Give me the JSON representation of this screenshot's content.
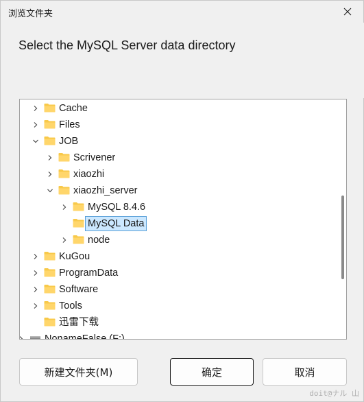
{
  "window": {
    "title": "浏览文件夹"
  },
  "instruction": "Select the MySQL Server data directory",
  "tree": {
    "items": [
      {
        "label": "Cache",
        "expanded": false,
        "has_children": true,
        "level": 0
      },
      {
        "label": "Files",
        "expanded": false,
        "has_children": true,
        "level": 0
      },
      {
        "label": "JOB",
        "expanded": true,
        "has_children": true,
        "level": 0
      },
      {
        "label": "Scrivener",
        "expanded": false,
        "has_children": true,
        "level": 1
      },
      {
        "label": "xiaozhi",
        "expanded": false,
        "has_children": true,
        "level": 1
      },
      {
        "label": "xiaozhi_server",
        "expanded": true,
        "has_children": true,
        "level": 1
      },
      {
        "label": "MySQL 8.4.6",
        "expanded": false,
        "has_children": true,
        "level": 2
      },
      {
        "label": "MySQL Data",
        "expanded": false,
        "has_children": false,
        "level": 2,
        "selected": true
      },
      {
        "label": "node",
        "expanded": false,
        "has_children": true,
        "level": 2
      },
      {
        "label": "KuGou",
        "expanded": false,
        "has_children": true,
        "level": 0
      },
      {
        "label": "ProgramData",
        "expanded": false,
        "has_children": true,
        "level": 0
      },
      {
        "label": "Software",
        "expanded": false,
        "has_children": true,
        "level": 0
      },
      {
        "label": "Tools",
        "expanded": false,
        "has_children": true,
        "level": 0
      },
      {
        "label": "迅雷下载",
        "expanded": false,
        "has_children": false,
        "level": 0
      },
      {
        "label": "NonameFalse (F:)",
        "expanded": false,
        "has_children": true,
        "level": -1,
        "icon": "drive-icon"
      }
    ]
  },
  "buttons": {
    "new_folder": "新建文件夹(M)",
    "ok": "确定",
    "cancel": "取消"
  },
  "watermark": "doit@ナル 山",
  "colors": {
    "folder": "#f8c94a",
    "selection_bg": "#cce8ff",
    "selection_border": "#5aa0d8"
  }
}
